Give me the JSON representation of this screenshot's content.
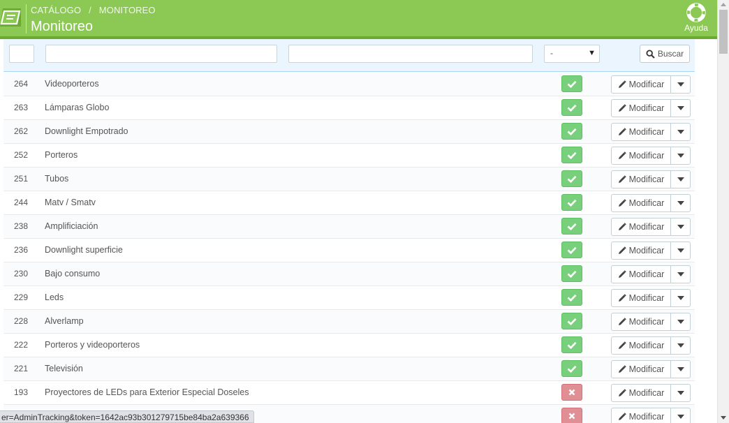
{
  "header": {
    "breadcrumb": [
      "CATÁLOGO",
      "MONITOREO"
    ],
    "breadcrumb_separator": "/",
    "title": "Monitoreo",
    "help_label": "Ayuda",
    "bg_color": "#8bc954"
  },
  "filters": {
    "id_value": "",
    "name_value": "",
    "third_value": "",
    "status_selected": "-",
    "search_label": "Buscar"
  },
  "rows": [
    {
      "id": "264",
      "name": "Videoporteros",
      "active": true,
      "action": "Modificar"
    },
    {
      "id": "263",
      "name": "Lámparas Globo",
      "active": true,
      "action": "Modificar"
    },
    {
      "id": "262",
      "name": "Downlight Empotrado",
      "active": true,
      "action": "Modificar"
    },
    {
      "id": "252",
      "name": "Porteros",
      "active": true,
      "action": "Modificar"
    },
    {
      "id": "251",
      "name": "Tubos",
      "active": true,
      "action": "Modificar"
    },
    {
      "id": "244",
      "name": "Matv / Smatv",
      "active": true,
      "action": "Modificar"
    },
    {
      "id": "238",
      "name": "Amplificiación",
      "active": true,
      "action": "Modificar"
    },
    {
      "id": "236",
      "name": "Downlight superficie",
      "active": true,
      "action": "Modificar"
    },
    {
      "id": "230",
      "name": "Bajo consumo",
      "active": true,
      "action": "Modificar"
    },
    {
      "id": "229",
      "name": "Leds",
      "active": true,
      "action": "Modificar"
    },
    {
      "id": "228",
      "name": "Alverlamp",
      "active": true,
      "action": "Modificar"
    },
    {
      "id": "222",
      "name": "Porteros y videoporteros",
      "active": true,
      "action": "Modificar"
    },
    {
      "id": "221",
      "name": "Televisión",
      "active": true,
      "action": "Modificar"
    },
    {
      "id": "193",
      "name": "Proyectores de LEDs para Exterior Especial Doseles",
      "active": false,
      "action": "Modificar"
    },
    {
      "id": "",
      "name": "",
      "active": false,
      "action": "Modificar"
    }
  ],
  "status_colors": {
    "active": "#78d07d",
    "inactive": "#e08f95"
  },
  "status_bar_url": "er=AdminTracking&token=1642ac93b301279715be84ba2a639366"
}
